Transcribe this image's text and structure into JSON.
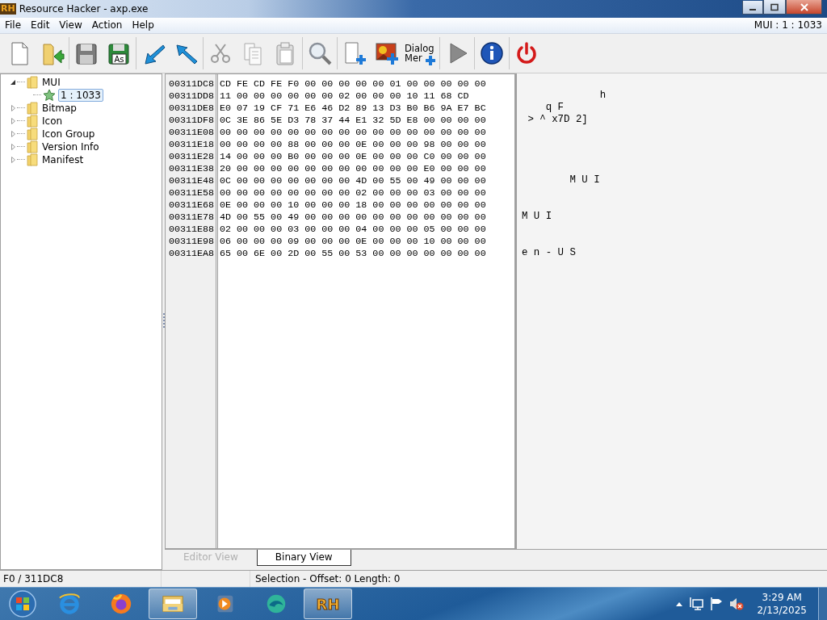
{
  "window": {
    "logo": "RH",
    "title": "Resource Hacker - axp.exe",
    "controls": [
      {
        "kind": "minimize"
      },
      {
        "kind": "maximize"
      },
      {
        "kind": "close"
      }
    ]
  },
  "menu": {
    "items": [
      "File",
      "Edit",
      "View",
      "Action",
      "Help"
    ],
    "resource_path": "MUI : 1 : 1033"
  },
  "toolbar": {
    "groups": [
      {
        "buttons": [
          {
            "kind": "new"
          },
          {
            "kind": "open"
          }
        ]
      },
      {
        "buttons": [
          {
            "kind": "save"
          },
          {
            "kind": "save-as",
            "label": "As"
          }
        ]
      },
      {
        "buttons": [
          {
            "kind": "import"
          },
          {
            "kind": "export"
          }
        ]
      },
      {
        "buttons": [
          {
            "kind": "cut"
          },
          {
            "kind": "copy"
          },
          {
            "kind": "paste"
          }
        ]
      },
      {
        "buttons": [
          {
            "kind": "find"
          }
        ]
      },
      {
        "buttons": [
          {
            "kind": "add"
          },
          {
            "kind": "add-image"
          },
          {
            "kind": "dialog-merge",
            "lines": [
              "Dialog",
              "Mer"
            ]
          }
        ]
      },
      {
        "buttons": [
          {
            "kind": "run"
          }
        ]
      },
      {
        "buttons": [
          {
            "kind": "info"
          }
        ]
      },
      {
        "buttons": [
          {
            "kind": "power"
          }
        ]
      }
    ]
  },
  "tree": {
    "items": [
      {
        "label": "MUI",
        "kind": "folder",
        "expanded": true,
        "selected": false,
        "children": [
          {
            "label": "1 : 1033",
            "kind": "resource",
            "selected": true
          }
        ]
      },
      {
        "label": "Bitmap",
        "kind": "folder",
        "expanded": false,
        "selected": false
      },
      {
        "label": "Icon",
        "kind": "folder",
        "expanded": false,
        "selected": false
      },
      {
        "label": "Icon Group",
        "kind": "folder",
        "expanded": false,
        "selected": false
      },
      {
        "label": "Version Info",
        "kind": "folder",
        "expanded": false,
        "selected": false
      },
      {
        "label": "Manifest",
        "kind": "folder",
        "expanded": false,
        "selected": false
      }
    ]
  },
  "hex": {
    "rows": [
      {
        "offset": "00311DC8",
        "bytes": "CD FE CD FE F0 00 00 00 00 00 01 00 00 00 00 00"
      },
      {
        "offset": "00311DD8",
        "bytes": "11 00 00 00 00 00 00 02 00 00 00 10 11 68 CD",
        "ascii": "             h"
      },
      {
        "offset": "00311DE8",
        "bytes": "E0 07 19 CF 71 E6 46 D2 89 13 D3 B0 B6 9A E7 BC",
        "ascii": "    q F"
      },
      {
        "offset": "00311DF8",
        "bytes": "0C 3E 86 5E D3 78 37 44 E1 32 5D E8 00 00 00 00",
        "ascii": " > ^ x7D 2]"
      },
      {
        "offset": "00311E08",
        "bytes": "00 00 00 00 00 00 00 00 00 00 00 00 00 00 00 00"
      },
      {
        "offset": "00311E18",
        "bytes": "00 00 00 00 88 00 00 00 0E 00 00 00 98 00 00 00"
      },
      {
        "offset": "00311E28",
        "bytes": "14 00 00 00 B0 00 00 00 0E 00 00 00 C0 00 00 00"
      },
      {
        "offset": "00311E38",
        "bytes": "20 00 00 00 00 00 00 00 00 00 00 00 E0 00 00 00"
      },
      {
        "offset": "00311E48",
        "bytes": "0C 00 00 00 00 00 00 00 4D 00 55 00 49 00 00 00",
        "ascii": "        M U I"
      },
      {
        "offset": "00311E58",
        "bytes": "00 00 00 00 00 00 00 00 02 00 00 00 03 00 00 00"
      },
      {
        "offset": "00311E68",
        "bytes": "0E 00 00 00 10 00 00 00 18 00 00 00 00 00 00 00"
      },
      {
        "offset": "00311E78",
        "bytes": "4D 00 55 00 49 00 00 00 00 00 00 00 00 00 00 00",
        "ascii": "M U I"
      },
      {
        "offset": "00311E88",
        "bytes": "02 00 00 00 03 00 00 00 04 00 00 00 05 00 00 00"
      },
      {
        "offset": "00311E98",
        "bytes": "06 00 00 00 09 00 00 00 0E 00 00 00 10 00 00 00"
      },
      {
        "offset": "00311EA8",
        "bytes": "65 00 6E 00 2D 00 55 00 53 00 00 00 00 00 00 00",
        "ascii": "e n - U S"
      }
    ]
  },
  "tabs": [
    {
      "label": "Editor View",
      "selected": false,
      "disabled": true
    },
    {
      "label": "Binary View",
      "selected": true,
      "disabled": false
    }
  ],
  "status_bar": {
    "position": "F0 / 311DC8",
    "selection": "Selection - Offset: 0 Length: 0"
  },
  "taskbar": {
    "apps": [
      {
        "kind": "browser-e",
        "active": false
      },
      {
        "kind": "browser-fox",
        "active": false
      },
      {
        "kind": "folder",
        "active": true
      },
      {
        "kind": "media",
        "active": false
      },
      {
        "kind": "swirl",
        "active": false
      },
      {
        "kind": "logo",
        "label": "RH",
        "active": true
      }
    ],
    "tray": {
      "time": "3:29 AM",
      "date": "2/13/2025"
    }
  }
}
